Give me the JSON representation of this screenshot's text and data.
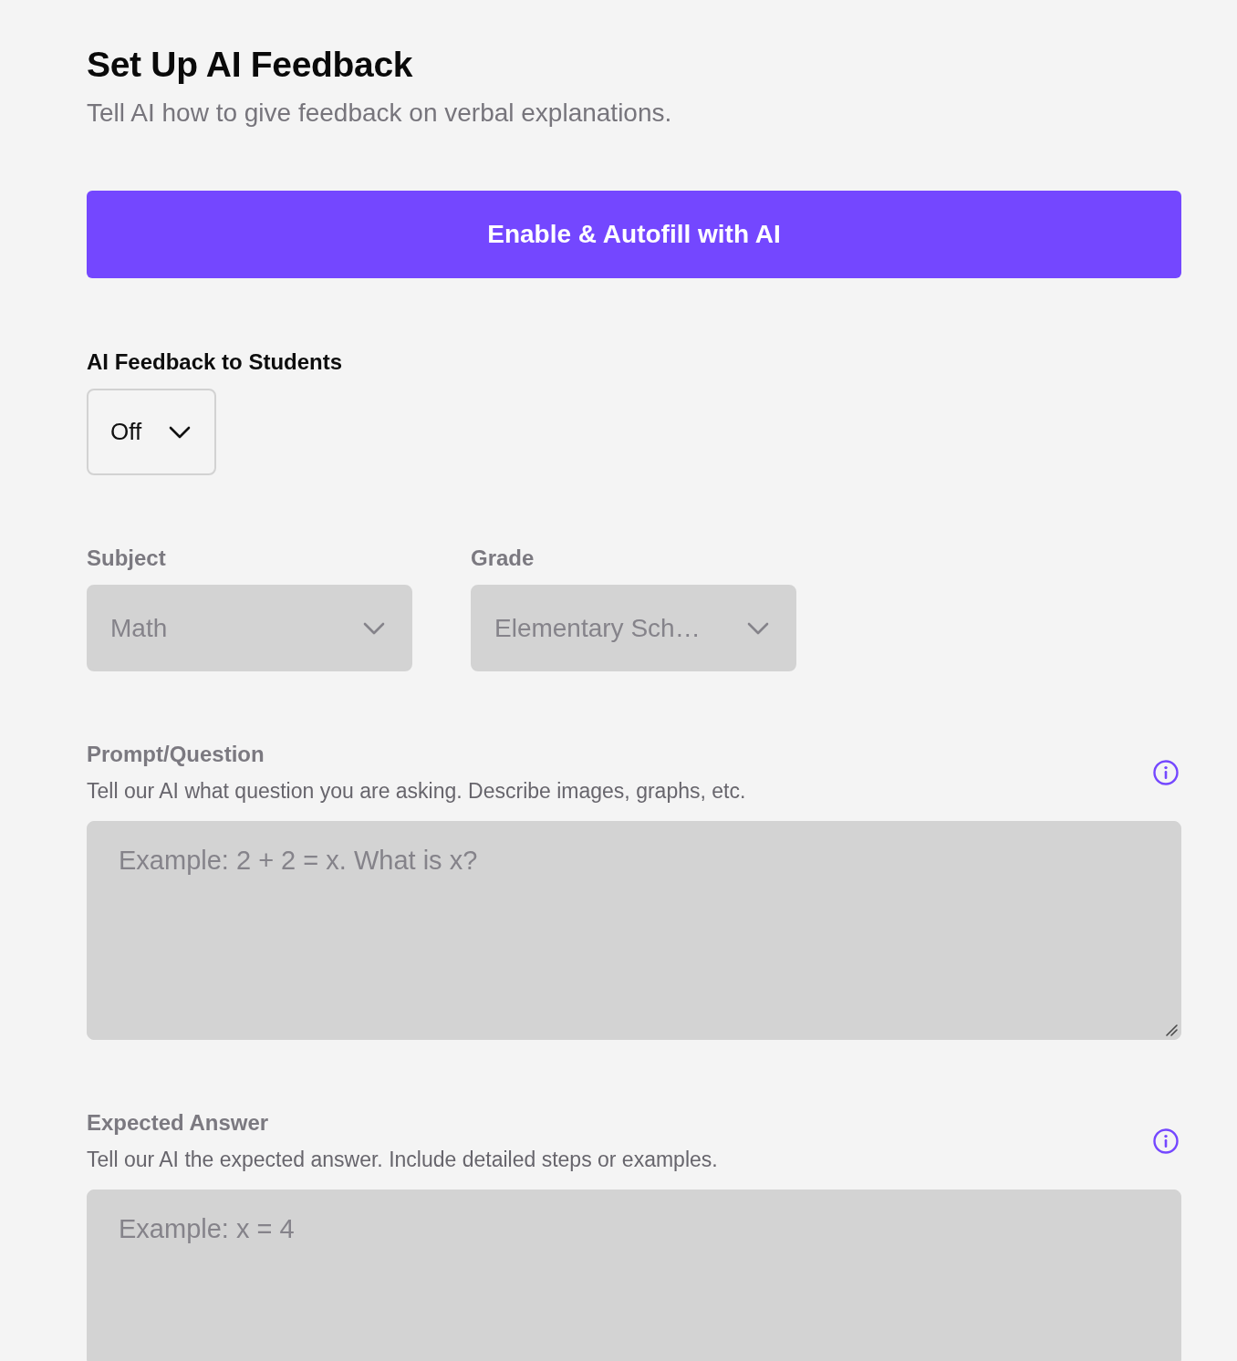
{
  "header": {
    "title": "Set Up AI Feedback",
    "subtitle": "Tell AI how to give feedback on verbal explanations."
  },
  "autofill_button": {
    "label": "Enable & Autofill with AI"
  },
  "feedback_setting": {
    "label": "AI Feedback to Students",
    "value": "Off",
    "disabled": false
  },
  "selects": [
    {
      "label": "Subject",
      "value": "Math",
      "disabled": true
    },
    {
      "label": "Grade",
      "value": "Elementary Sch…",
      "disabled": true
    }
  ],
  "text_fields": [
    {
      "label": "Prompt/Question",
      "hint": "Tell our AI what question you are asking. Describe images, graphs, etc.",
      "placeholder": "Example: 2 + 2 = x. What is x?",
      "disabled": true
    },
    {
      "label": "Expected Answer",
      "hint": "Tell our AI the expected answer. Include detailed steps or examples.",
      "placeholder": "Example: x = 4",
      "disabled": true
    }
  ]
}
